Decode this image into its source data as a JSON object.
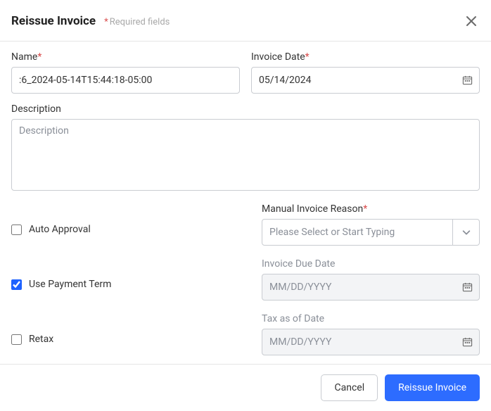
{
  "header": {
    "title": "Reissue Invoice",
    "required_hint": "Required fields"
  },
  "fields": {
    "name": {
      "label": "Name",
      "value": ":6_2024-05-14T15:44:18-05:00"
    },
    "invoice_date": {
      "label": "Invoice Date",
      "value": "05/14/2024"
    },
    "description": {
      "label": "Description",
      "placeholder": "Description"
    },
    "auto_approval": {
      "label": "Auto Approval",
      "checked": false
    },
    "manual_invoice_reason": {
      "label": "Manual Invoice Reason",
      "placeholder": "Please Select or Start Typing"
    },
    "use_payment_term": {
      "label": "Use Payment Term",
      "checked": true
    },
    "invoice_due_date": {
      "label": "Invoice Due Date",
      "placeholder": "MM/DD/YYYY"
    },
    "retax": {
      "label": "Retax",
      "checked": false
    },
    "tax_as_of_date": {
      "label": "Tax as of Date",
      "placeholder": "MM/DD/YYYY"
    }
  },
  "footer": {
    "cancel": "Cancel",
    "submit": "Reissue Invoice"
  }
}
